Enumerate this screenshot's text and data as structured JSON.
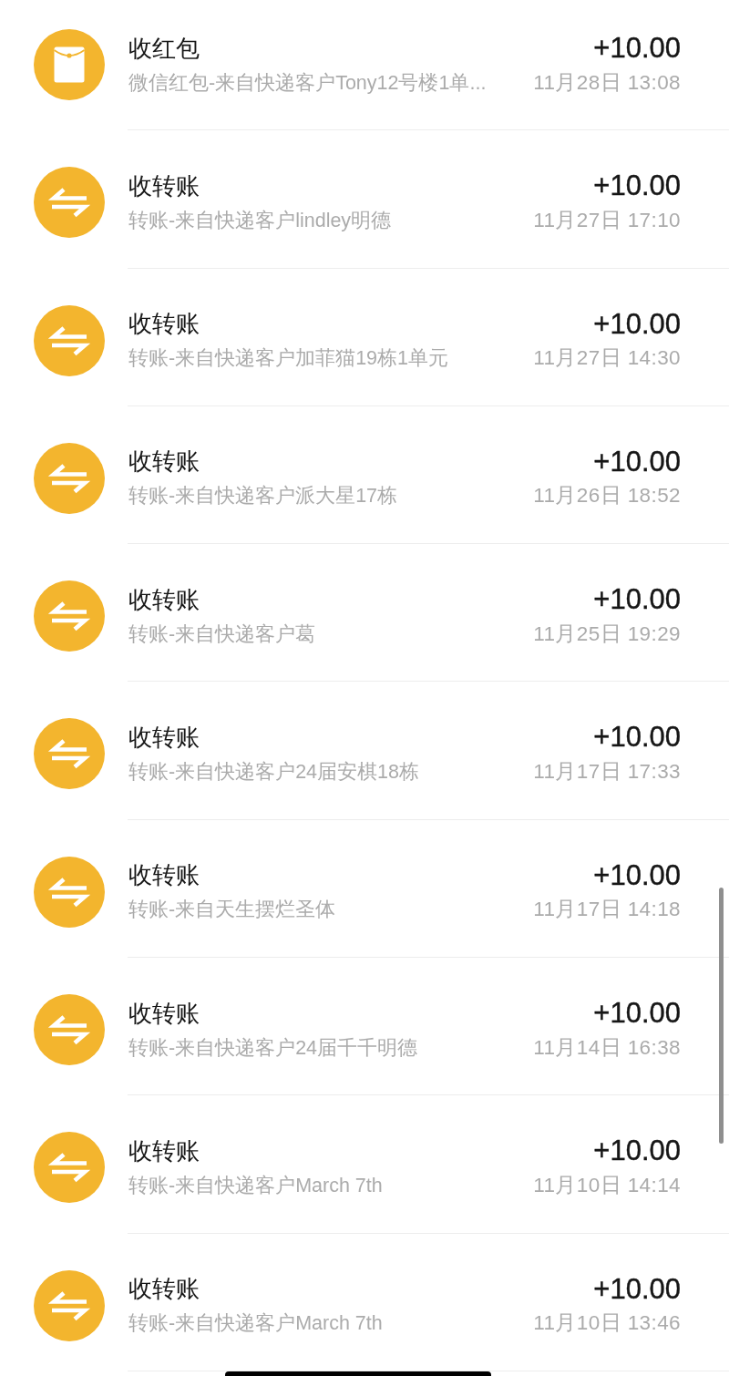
{
  "transactions": [
    {
      "kind": "red_packet",
      "title": "收红包",
      "description": "微信红包-来自快递客户Tony12号楼1单...",
      "amount": "+10.00",
      "time": "11月28日 13:08"
    },
    {
      "kind": "transfer",
      "title": "收转账",
      "description": "转账-来自快递客户lindley明德",
      "amount": "+10.00",
      "time": "11月27日 17:10"
    },
    {
      "kind": "transfer",
      "title": "收转账",
      "description": "转账-来自快递客户加菲猫19栋1单元",
      "amount": "+10.00",
      "time": "11月27日 14:30"
    },
    {
      "kind": "transfer",
      "title": "收转账",
      "description": "转账-来自快递客户派大星17栋",
      "amount": "+10.00",
      "time": "11月26日 18:52"
    },
    {
      "kind": "transfer",
      "title": "收转账",
      "description": "转账-来自快递客户葛",
      "amount": "+10.00",
      "time": "11月25日 19:29"
    },
    {
      "kind": "transfer",
      "title": "收转账",
      "description": "转账-来自快递客户24届安棋18栋",
      "amount": "+10.00",
      "time": "11月17日 17:33"
    },
    {
      "kind": "transfer",
      "title": "收转账",
      "description": "转账-来自天生摆烂圣体",
      "amount": "+10.00",
      "time": "11月17日 14:18"
    },
    {
      "kind": "transfer",
      "title": "收转账",
      "description": "转账-来自快递客户24届千千明德",
      "amount": "+10.00",
      "time": "11月14日 16:38"
    },
    {
      "kind": "transfer",
      "title": "收转账",
      "description": "转账-来自快递客户March 7th",
      "amount": "+10.00",
      "time": "11月10日 14:14"
    },
    {
      "kind": "transfer",
      "title": "收转账",
      "description": "转账-来自快递客户March 7th",
      "amount": "+10.00",
      "time": "11月10日 13:46"
    }
  ]
}
